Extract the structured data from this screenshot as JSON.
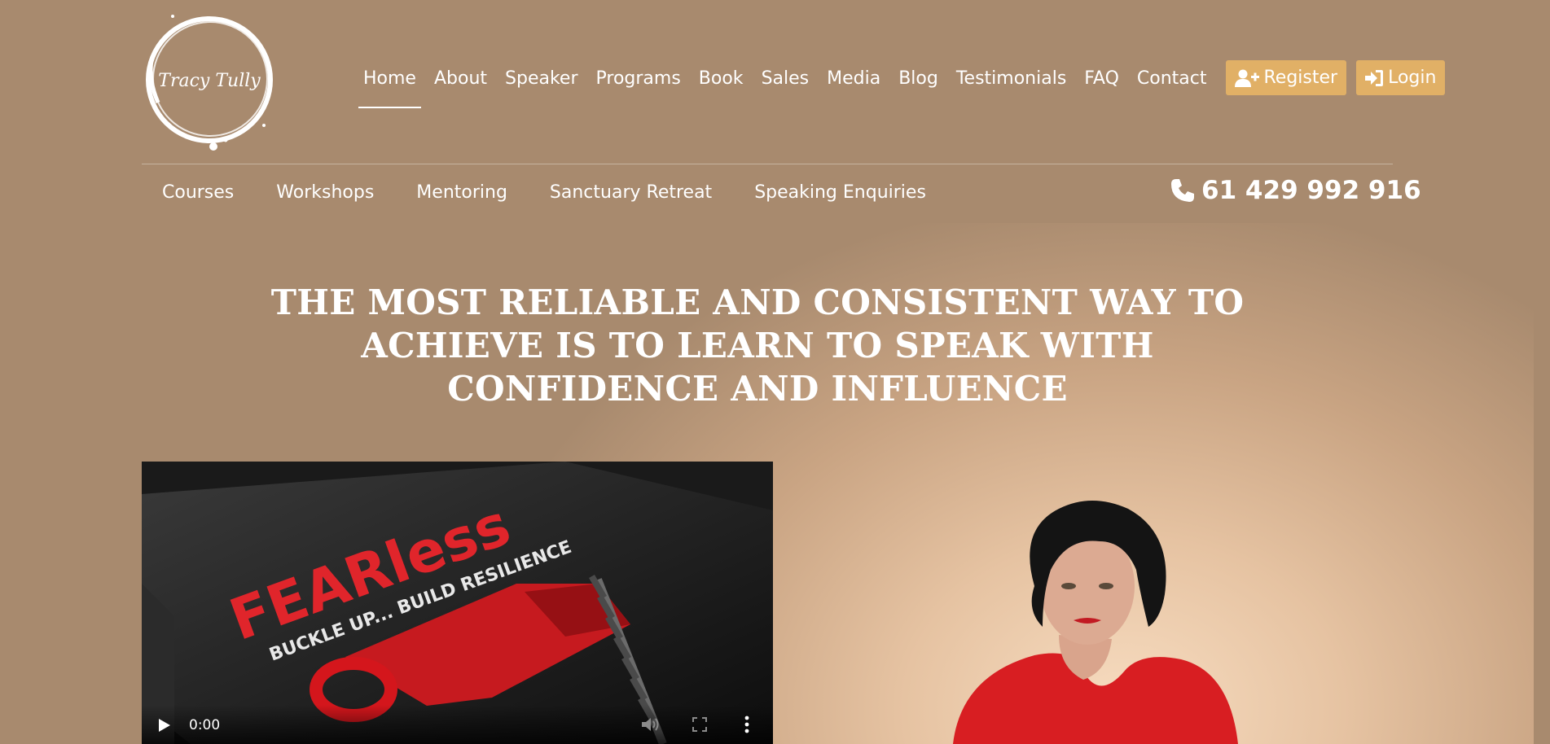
{
  "logo": {
    "text": "Tracy Tully"
  },
  "nav": {
    "items": [
      "Home",
      "About",
      "Speaker",
      "Programs",
      "Book",
      "Sales",
      "Media",
      "Blog",
      "Testimonials",
      "FAQ",
      "Contact"
    ],
    "active": "Home",
    "register_label": "Register",
    "login_label": "Login"
  },
  "subnav": {
    "items": [
      "Courses",
      "Workshops",
      "Mentoring",
      "Sanctuary Retreat",
      "Speaking Enquiries"
    ]
  },
  "phone": {
    "number": "61 429 992 916",
    "icon": "phone-icon"
  },
  "hero": {
    "headline_lines": [
      "THE MOST RELIABLE AND CONSISTENT WAY TO",
      "ACHIEVE IS TO LEARN TO SPEAK WITH",
      "CONFIDENCE AND INFLUENCE"
    ]
  },
  "video": {
    "poster_text_title": "FEARless",
    "poster_text_subtitle": "BUCKLE UP... BUILD RESILIENCE",
    "time": "0:00",
    "icons": [
      "play-icon",
      "mute-icon",
      "fullscreen-icon",
      "more-icon"
    ]
  },
  "colors": {
    "background": "#a88a6e",
    "button": "#e1b066",
    "text": "#ffffff"
  }
}
